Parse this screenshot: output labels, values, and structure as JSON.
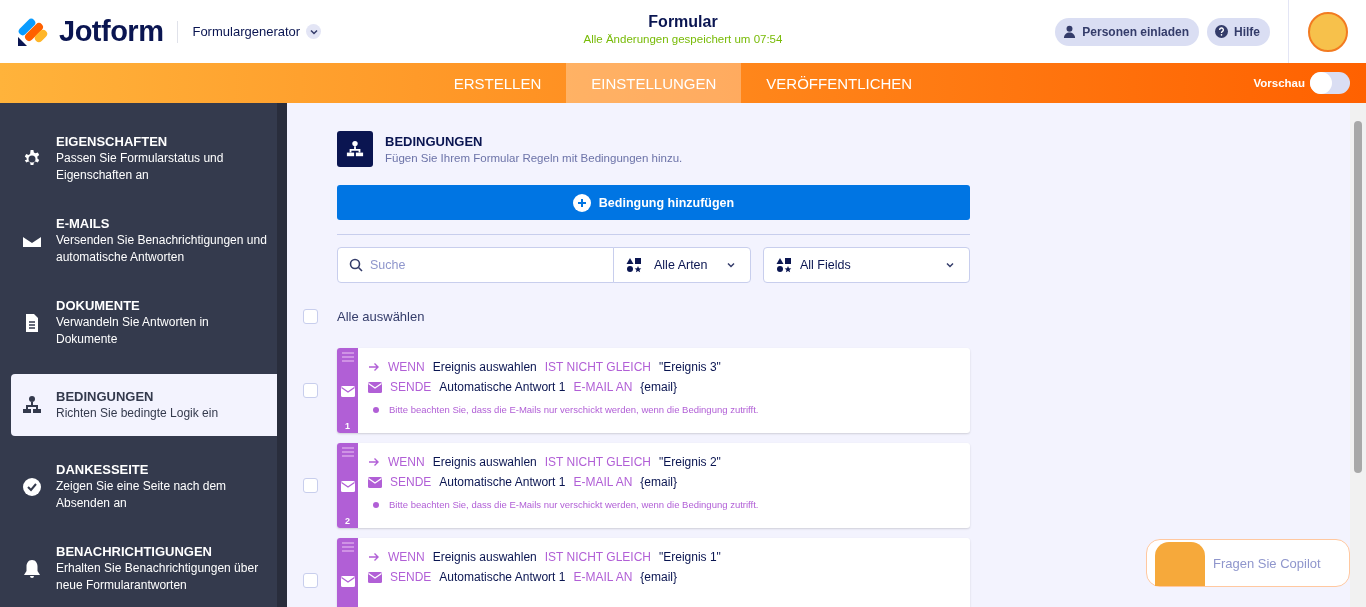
{
  "header": {
    "logo": "Jotform",
    "builder_menu": "Formulargenerator",
    "title": "Formular",
    "save_status": "Alle Änderungen gespeichert um 07:54",
    "buttons": [
      {
        "kind": "invite",
        "label": "Personen einladen"
      },
      {
        "kind": "help",
        "label": "Hilfe"
      }
    ]
  },
  "tabs": [
    {
      "label": "ERSTELLEN",
      "selected": false
    },
    {
      "label": "EINSTELLUNGEN",
      "selected": true
    },
    {
      "label": "VERÖFFENTLICHEN",
      "selected": false
    }
  ],
  "preview": {
    "label": "Vorschau",
    "on": false
  },
  "sidebar": {
    "items": [
      {
        "title": "EIGENSCHAFTEN",
        "description": "Passen Sie Formularstatus und Eigenschaften an",
        "selected": false
      },
      {
        "title": "E-MAILS",
        "description": "Versenden Sie Benachrichtigungen und automatische Antworten",
        "selected": false
      },
      {
        "title": "DOKUMENTE",
        "description": "Verwandeln Sie Antworten in Dokumente",
        "selected": false
      },
      {
        "title": "BEDINGUNGEN",
        "description": "Richten Sie bedingte Logik ein",
        "selected": true
      },
      {
        "title": "DANKESSEITE",
        "description": "Zeigen Sie eine Seite nach dem Absenden an",
        "selected": false
      },
      {
        "title": "BENACHRICHTIGUNGEN",
        "description": "Erhalten Sie Benachrichtigungen über neue Formularantworten",
        "selected": false
      }
    ]
  },
  "section": {
    "title": "BEDINGUNGEN",
    "subtitle": "Fügen Sie Ihrem Formular Regeln mit Bedingungen hinzu.",
    "add_button": "Bedingung hinzufügen"
  },
  "filters": {
    "search_placeholder": "Suche",
    "type_filter": "Alle Arten",
    "field_filter": "All Fields"
  },
  "select_all": {
    "label": "Alle auswählen",
    "checked": false
  },
  "rules": [
    {
      "number": "1",
      "checked": false,
      "lines": [
        {
          "kind": "when",
          "keyword": "WENN",
          "field": "Ereignis auswahlen",
          "operator": "IST NICHT GLEICH",
          "value": "\"Ereignis 3\""
        },
        {
          "kind": "send",
          "keyword": "SENDE",
          "field": "Automatische Antwort 1",
          "operator": "E-MAIL AN",
          "value": "{email}"
        }
      ],
      "note": "Bitte beachten Sie, dass die E-Mails nur verschickt werden, wenn die Bedingung zutrifft."
    },
    {
      "number": "2",
      "checked": false,
      "lines": [
        {
          "kind": "when",
          "keyword": "WENN",
          "field": "Ereignis auswahlen",
          "operator": "IST NICHT GLEICH",
          "value": "\"Ereignis 2\""
        },
        {
          "kind": "send",
          "keyword": "SENDE",
          "field": "Automatische Antwort 1",
          "operator": "E-MAIL AN",
          "value": "{email}"
        }
      ],
      "note": "Bitte beachten Sie, dass die E-Mails nur verschickt werden, wenn die Bedingung zutrifft."
    },
    {
      "checked": false,
      "lines": [
        {
          "kind": "when",
          "keyword": "WENN",
          "field": "Ereignis auswahlen",
          "operator": "IST NICHT GLEICH",
          "value": "\"Ereignis 1\""
        },
        {
          "kind": "send",
          "keyword": "SENDE",
          "field": "Automatische Antwort 1",
          "operator": "E-MAIL AN",
          "value": "{email}"
        }
      ]
    }
  ],
  "copilot": {
    "label": "Fragen Sie Copilot"
  }
}
